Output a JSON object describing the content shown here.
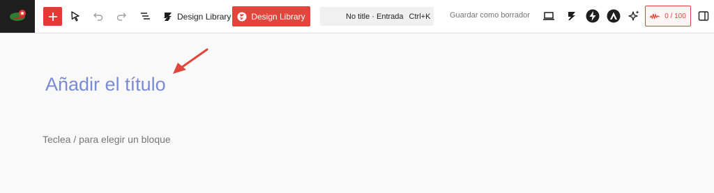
{
  "toolbar": {
    "add_block_label": "+",
    "design_library_label": "Design Library",
    "design_library_red_label": "Design Library",
    "command_center": {
      "title": "No title · Entrada",
      "shortcut": "Ctrl+K"
    },
    "save_draft_label": "Guardar como borrador",
    "score_label": "0 / 100"
  },
  "editor": {
    "title_placeholder": "Añadir el título",
    "block_placeholder": "Teclea / para elegir un bloque"
  },
  "icons": {
    "site": "site-logo-icon",
    "select_tool": "cursor-icon",
    "undo": "undo-icon",
    "redo": "redo-icon",
    "list_view": "list-view-icon",
    "stackable": "stackable-s-icon",
    "preview": "laptop-icon",
    "plugin_a": "stackable-s-icon",
    "plugin_b": "lightning-icon",
    "plugin_c": "astra-a-icon",
    "ai": "sparkles-icon",
    "settings": "sidebar-toggle-icon",
    "annotation": "red-arrow-icon"
  },
  "colors": {
    "accent_red": "#e2453b",
    "title_blue": "#7a8bd6",
    "site_bg": "#1e1e1e"
  }
}
